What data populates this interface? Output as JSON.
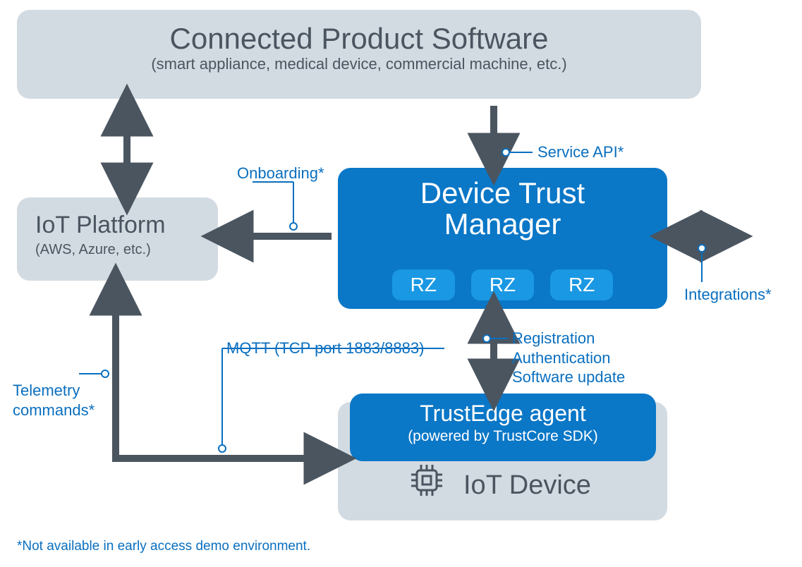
{
  "boxes": {
    "cps": {
      "title": "Connected Product Software",
      "subtitle": "(smart appliance, medical device, commercial machine, etc.)"
    },
    "iot_platform": {
      "title": "IoT Platform",
      "subtitle": "(AWS, Azure, etc.)"
    },
    "dtm": {
      "title_line1": "Device Trust",
      "title_line2": "Manager",
      "rz": [
        "RZ",
        "RZ",
        "RZ"
      ]
    },
    "trustedge": {
      "title": "TrustEdge agent",
      "subtitle": "(powered by TrustCore SDK)"
    },
    "iot_device": {
      "label": "IoT Device"
    }
  },
  "annotations": {
    "service_api": "Service API*",
    "onboarding": "Onboarding*",
    "integrations": "Integrations*",
    "mqtt": "MQTT (TCP port 1883/8883)",
    "reg_auth_update_1": "Registration",
    "reg_auth_update_2": "Authentication",
    "reg_auth_update_3": "Software update",
    "telemetry_1": "Telemetry",
    "telemetry_2": "commands*"
  },
  "footnote": "*Not available in early access demo environment."
}
